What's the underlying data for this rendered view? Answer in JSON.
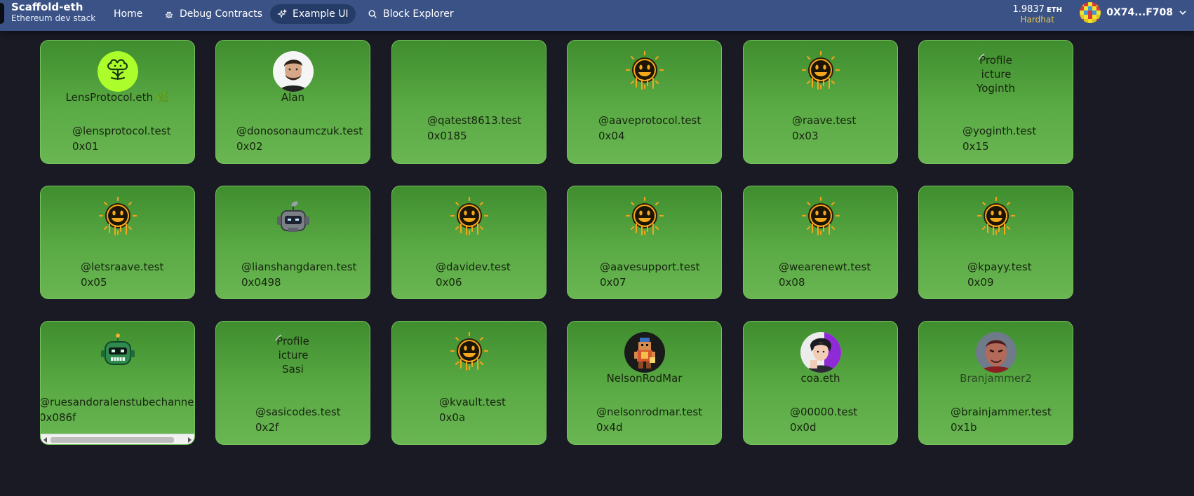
{
  "brand": {
    "title": "Scaffold-eth",
    "subtitle": "Ethereum dev stack"
  },
  "nav": [
    {
      "label": "Home",
      "icon": "none",
      "active": false
    },
    {
      "label": "Debug Contracts",
      "icon": "bug-icon",
      "active": false
    },
    {
      "label": "Example UI",
      "icon": "sparkles-icon",
      "active": true
    },
    {
      "label": "Block Explorer",
      "icon": "search-icon",
      "active": false
    }
  ],
  "wallet": {
    "balance": "1.9837",
    "unit": "ETH",
    "network": "Hardhat",
    "address": "0X74...F708"
  },
  "profiles": [
    {
      "name": "LensProtocol.eth 🌿",
      "handle": "@lensprotocol.test",
      "id": "0x01",
      "avatar": "lens-icon"
    },
    {
      "name": "Alan",
      "handle": "@donosonaumczuk.test",
      "id": "0x02",
      "avatar": "person-photo"
    },
    {
      "name": "",
      "handle": "@qatest8613.test",
      "id": "0x0185",
      "avatar": "none"
    },
    {
      "name": "",
      "handle": "@aaveprotocol.test",
      "id": "0x04",
      "avatar": "aave-ghost-icon"
    },
    {
      "name": "",
      "handle": "@raave.test",
      "id": "0x03",
      "avatar": "aave-ghost-icon"
    },
    {
      "name": "",
      "handle": "@yoginth.test",
      "id": "0x15",
      "avatar": "broken-image",
      "alt": [
        "Profile",
        "picture",
        "Yoginth"
      ]
    },
    {
      "name": "",
      "handle": "@letsraave.test",
      "id": "0x05",
      "avatar": "aave-ghost-icon"
    },
    {
      "name": "",
      "handle": "@lianshangdaren.test",
      "id": "0x0498",
      "avatar": "robot-grey-icon"
    },
    {
      "name": "",
      "handle": "@davidev.test",
      "id": "0x06",
      "avatar": "aave-ghost-icon"
    },
    {
      "name": "",
      "handle": "@aavesupport.test",
      "id": "0x07",
      "avatar": "aave-ghost-icon"
    },
    {
      "name": "",
      "handle": "@wearenewt.test",
      "id": "0x08",
      "avatar": "aave-ghost-icon"
    },
    {
      "name": "",
      "handle": "@kpayy.test",
      "id": "0x09",
      "avatar": "aave-ghost-icon"
    },
    {
      "name": "",
      "handle": "@ruesandoralenstubechannel.test",
      "id": "0x086f",
      "avatar": "robot-green-icon"
    },
    {
      "name": "",
      "handle": "@sasicodes.test",
      "id": "0x2f",
      "avatar": "broken-image",
      "alt": [
        "Profile",
        "picture",
        "Sasi"
      ]
    },
    {
      "name": "",
      "handle": "@kvault.test",
      "id": "0x0a",
      "avatar": "aave-ghost-icon"
    },
    {
      "name": "NelsonRodMar",
      "handle": "@nelsonrodmar.test",
      "id": "0x4d",
      "avatar": "pixel-warrior-icon"
    },
    {
      "name": "coa.eth",
      "handle": "@00000.test",
      "id": "0x0d",
      "avatar": "anime-person-icon"
    },
    {
      "name": "Branjammer2",
      "handle": "@brainjammer.test",
      "id": "0x1b",
      "avatar": "fighter-portrait-icon"
    }
  ]
}
